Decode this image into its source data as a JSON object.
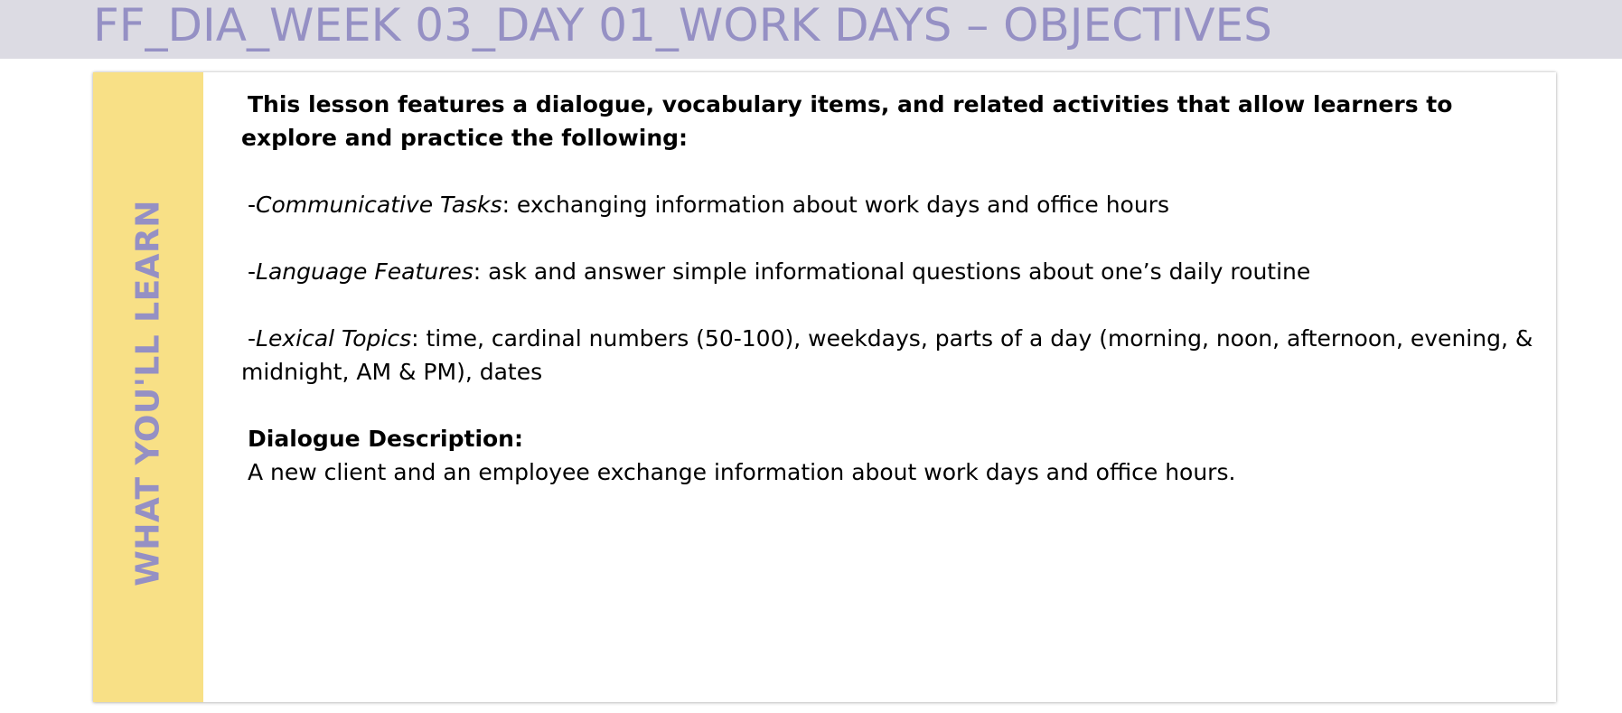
{
  "header": {
    "title": "FF_DIA_WEEK 03_DAY 01_WORK DAYS – OBJECTIVES"
  },
  "sidebar": {
    "label": "WHAT YOU'LL LEARN"
  },
  "content": {
    "intro": "This lesson features a dialogue, vocabulary items, and related activities that allow learners to explore and practice the following:",
    "items": [
      {
        "prefix": "-",
        "term": "Communicative Tasks",
        "text": ": exchanging information about work days and office hours"
      },
      {
        "prefix": "-",
        "term": "Language Features",
        "text": ": ask and answer simple informational questions about one’s daily routine"
      },
      {
        "prefix": "-",
        "term": "Lexical Topics",
        "text": ":  time, cardinal numbers (50-100), weekdays, parts of a day (morning, noon, afternoon, evening, & midnight, AM & PM), dates"
      }
    ],
    "dialogue_heading": "Dialogue Description:",
    "dialogue_text": "A new client and an employee exchange information about work days and office hours."
  },
  "colors": {
    "title": "#9590c4",
    "header_band": "#dcdbe3",
    "sidebar": "#f8e086"
  }
}
